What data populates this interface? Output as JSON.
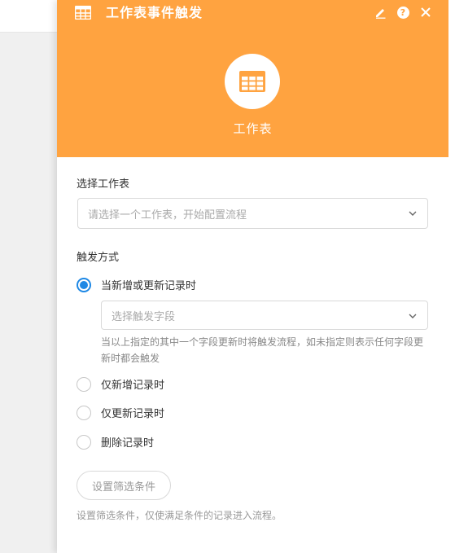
{
  "colors": {
    "accent": "#ffa340",
    "radio": "#1e88e5",
    "text": "#333333",
    "muted": "#999999"
  },
  "header": {
    "title": "工作表事件触发",
    "hero_title": "工作表",
    "icons": [
      "table-icon",
      "edit-icon",
      "help-icon",
      "close-icon"
    ]
  },
  "sheet": {
    "label": "选择工作表",
    "placeholder": "请选择一个工作表，开始配置流程"
  },
  "trigger": {
    "label": "触发方式",
    "options": [
      {
        "label": "当新增或更新记录时",
        "checked": true
      },
      {
        "label": "仅新增记录时",
        "checked": false
      },
      {
        "label": "仅更新记录时",
        "checked": false
      },
      {
        "label": "删除记录时",
        "checked": false
      }
    ],
    "field_placeholder": "选择触发字段",
    "field_hint": "当以上指定的其中一个字段更新时将触发流程，如未指定则表示任何字段更新时都会触发"
  },
  "filter": {
    "button_label": "设置筛选条件",
    "hint": "设置筛选条件，仅使满足条件的记录进入流程。"
  }
}
